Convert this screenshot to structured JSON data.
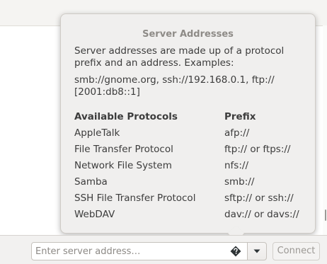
{
  "popover": {
    "title": "Server Addresses",
    "description_line1": "Server addresses are made up of a protocol",
    "description_line2": "prefix and an address. Examples:",
    "examples_line1": "smb://gnome.org, ssh://192.168.0.1, ftp://",
    "examples_line2": "[2001:db8::1]",
    "table": {
      "headers": [
        "Available Protocols",
        "Prefix"
      ],
      "rows": [
        [
          "AppleTalk",
          "afp://"
        ],
        [
          "File Transfer Protocol",
          "ftp:// or ftps://"
        ],
        [
          "Network File System",
          "nfs://"
        ],
        [
          "Samba",
          "smb://"
        ],
        [
          "SSH File Transfer Protocol",
          "sftp:// or ssh://"
        ],
        [
          "WebDAV",
          "dav:// or davs://"
        ]
      ]
    }
  },
  "connect_bar": {
    "address_placeholder": "Enter server address…",
    "address_value": "",
    "help_icon": "question-diamond-icon",
    "dropdown_icon": "triangle-down-icon",
    "connect_label": "Connect"
  },
  "colors": {
    "popover_bg": "#f0efee",
    "title_text": "#8e8b87",
    "body_text": "#3c3c3c",
    "disabled_text": "#9b9894"
  }
}
